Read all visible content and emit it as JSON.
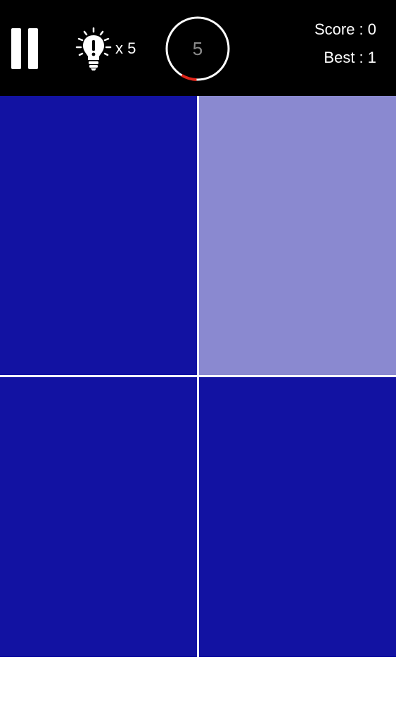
{
  "hud": {
    "pause_icon": "pause-icon",
    "hint_icon": "lightbulb-icon",
    "hint_count": "x 5",
    "timer_value": "5",
    "timer_progress": 0.08,
    "score": "Score : 0",
    "best": "Best : 1"
  },
  "colors": {
    "top_bar": "#000000",
    "tile_base": "#1212a2",
    "tile_odd": "#8a89d0",
    "timer_ring": "#ffffff",
    "timer_progress": "#e0261b",
    "grid_line": "#ffffff"
  },
  "tiles": [
    {
      "state": "base"
    },
    {
      "state": "odd"
    },
    {
      "state": "base"
    },
    {
      "state": "base"
    }
  ]
}
